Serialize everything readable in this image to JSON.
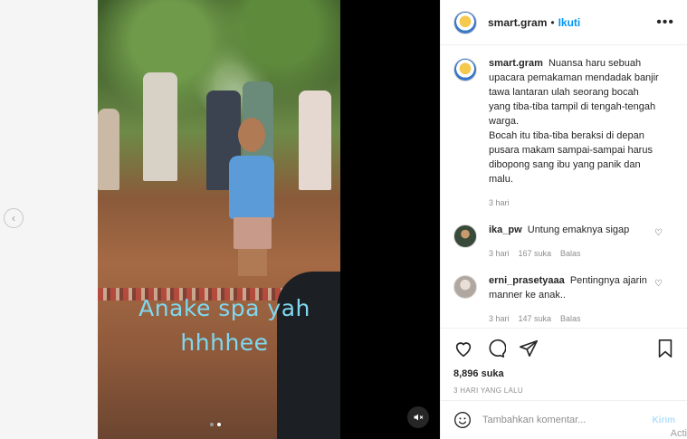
{
  "header": {
    "username": "smart.gram",
    "separator": "•",
    "follow_label": "Ikuti",
    "more_icon": "more-horizontal-icon"
  },
  "media": {
    "overlay_line1": "Anake spa yah",
    "overlay_line2": "hhhhee",
    "carousel_dots": 2,
    "active_dot": 2
  },
  "caption": {
    "username": "smart.gram",
    "text": "Nuansa haru sebuah upacara pemakaman mendadak banjir tawa lantaran ulah seorang bocah yang tiba-tiba tampil di tengah-tengah warga.",
    "text2": "Bocah itu tiba-tiba beraksi di depan pusara makam sampai-sampai harus dibopong sang ibu yang panik dan malu.",
    "time": "3 hari"
  },
  "comments": [
    {
      "username": "ika_pw",
      "text": "Untung emaknya sigap",
      "time": "3 hari",
      "likes": "167 suka",
      "reply": "Balas"
    },
    {
      "username": "erni_prasetyaaa",
      "text": "Pentingnya ajarin manner ke anak..",
      "time": "3 hari",
      "likes": "147 suka",
      "reply": "Balas"
    }
  ],
  "actions": {
    "likes": "8,896 suka",
    "date": "3 HARI YANG LALU"
  },
  "add_comment": {
    "placeholder": "Tambahkan komentar...",
    "post_label": "Kirim"
  },
  "watermark": "Acti"
}
